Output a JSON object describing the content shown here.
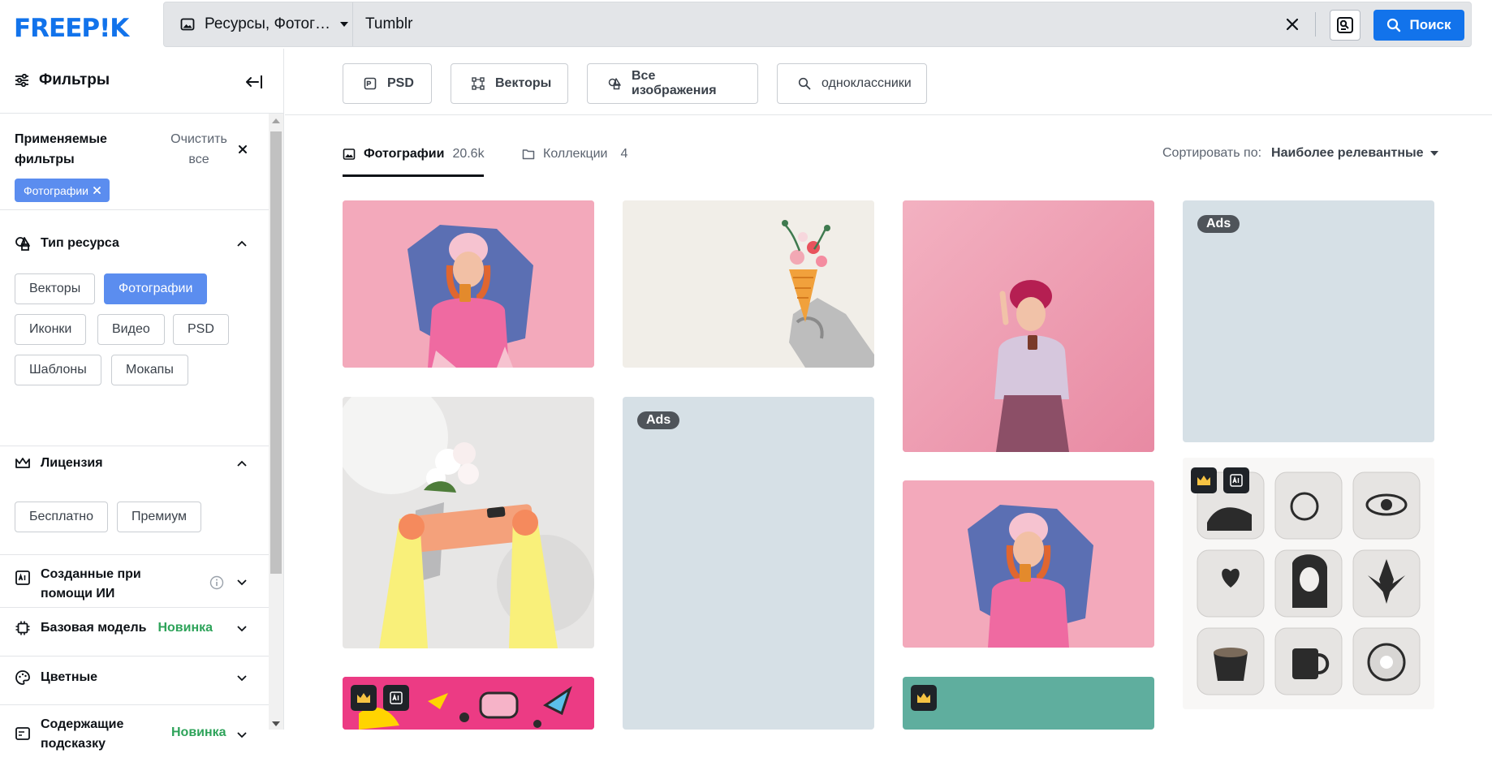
{
  "logo": "FREEP!K",
  "search": {
    "type_label": "Ресурсы, Фотог…",
    "query": "Tumblr",
    "button_label": "Поиск"
  },
  "sidebar": {
    "title": "Фильтры",
    "applied_title": "Применяемые фильтры",
    "clear_all": "Очистить все",
    "applied_chip": "Фотографии",
    "resource_type": {
      "title": "Тип ресурса",
      "options": [
        "Векторы",
        "Фотографии",
        "Иконки",
        "Видео",
        "PSD",
        "Шаблоны",
        "Мокапы"
      ],
      "selected": "Фотографии"
    },
    "license": {
      "title": "Лицензия",
      "options": [
        "Бесплатно",
        "Премиум"
      ]
    },
    "ai": {
      "title": "Созданные при помощи ИИ"
    },
    "base_model": {
      "title": "Базовая модель",
      "tag": "Новинка"
    },
    "colors": {
      "title": "Цветные"
    },
    "prompt": {
      "title": "Содержащие подсказку",
      "tag": "Новинка"
    }
  },
  "quick_filters": [
    "PSD",
    "Векторы",
    "Все изображения",
    "одноклассники"
  ],
  "tabs": [
    {
      "label": "Фотографии",
      "count": "20.6k"
    },
    {
      "label": "Коллекции",
      "count": "4"
    }
  ],
  "sort": {
    "label": "Сортировать по:",
    "value": "Наиболее релевантные"
  },
  "ads_label": "Ads",
  "colors": {
    "brand": "#1273eb",
    "active_chip": "#5b8def",
    "new_tag": "#2ea35a",
    "ads_placeholder": "#d6e0e6"
  }
}
